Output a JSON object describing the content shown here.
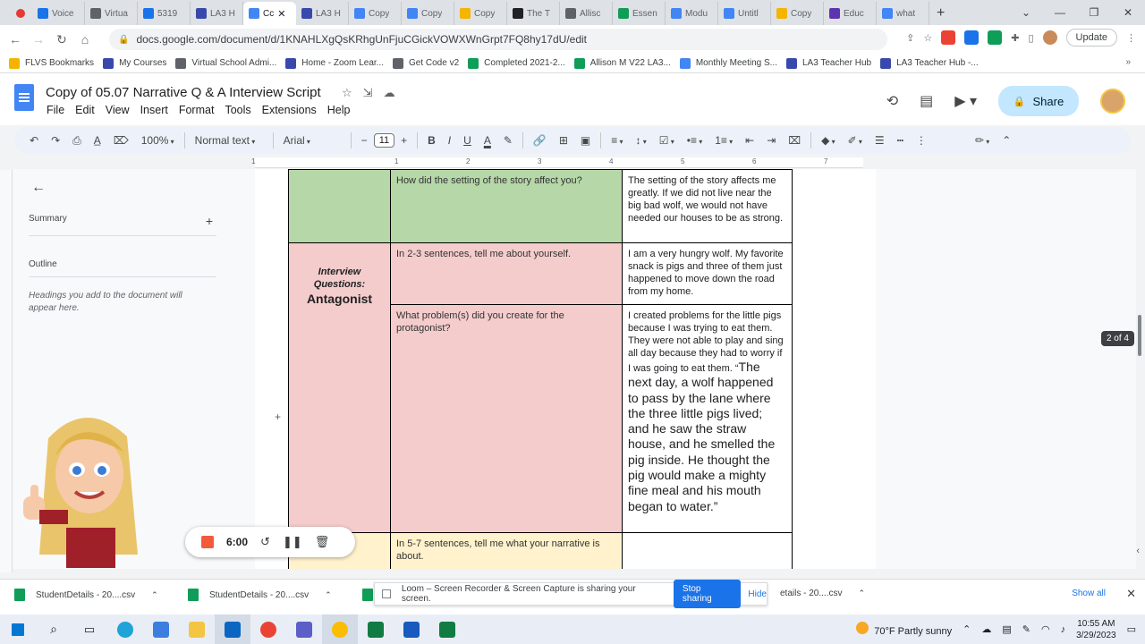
{
  "browser": {
    "tabs": [
      {
        "label": "Voice",
        "color": "#1a73e8"
      },
      {
        "label": "Virtua",
        "color": "#5f6368"
      },
      {
        "label": "5319",
        "color": "#1a73e8"
      },
      {
        "label": "LA3 H",
        "color": "#3949ab"
      },
      {
        "label": "Cc",
        "color": "#4285f4",
        "active": true
      },
      {
        "label": "LA3 H",
        "color": "#3949ab"
      },
      {
        "label": "Copy",
        "color": "#4285f4"
      },
      {
        "label": "Copy",
        "color": "#4285f4"
      },
      {
        "label": "Copy",
        "color": "#f4b400"
      },
      {
        "label": "The T",
        "color": "#202124"
      },
      {
        "label": "Allisc",
        "color": "#5f6368"
      },
      {
        "label": "Essen",
        "color": "#0f9d58"
      },
      {
        "label": "Modu",
        "color": "#4285f4"
      },
      {
        "label": "Untitl",
        "color": "#4285f4"
      },
      {
        "label": "Copy",
        "color": "#f4b400"
      },
      {
        "label": "Educ",
        "color": "#5e35b1"
      },
      {
        "label": "what",
        "color": "#4285f4"
      }
    ],
    "new_tab": "+",
    "url": "docs.google.com/document/d/1KNAHLXgQsKRhgUnFjuCGickVOWXWnGrpt7FQ8hy17dU/edit",
    "update_label": "Update",
    "bookmarks": [
      {
        "label": "FLVS Bookmarks",
        "color": "#f4b400"
      },
      {
        "label": "My Courses",
        "color": "#3949ab"
      },
      {
        "label": "Virtual School Admi...",
        "color": "#5f6368"
      },
      {
        "label": "Home - Zoom Lear...",
        "color": "#3949ab"
      },
      {
        "label": "Get Code v2",
        "color": "#5f6368"
      },
      {
        "label": "Completed 2021-2...",
        "color": "#0f9d58"
      },
      {
        "label": "Allison M V22 LA3...",
        "color": "#0f9d58"
      },
      {
        "label": "Monthly Meeting S...",
        "color": "#4285f4"
      },
      {
        "label": "LA3 Teacher Hub",
        "color": "#3949ab"
      },
      {
        "label": "LA3 Teacher Hub -...",
        "color": "#3949ab"
      }
    ]
  },
  "docs": {
    "title": "Copy of 05.07 Narrative Q & A Interview Script",
    "menu": [
      "File",
      "Edit",
      "View",
      "Insert",
      "Format",
      "Tools",
      "Extensions",
      "Help"
    ],
    "share_label": "Share",
    "toolbar": {
      "zoom": "100%",
      "style": "Normal text",
      "font": "Arial",
      "font_size": "11"
    },
    "ruler_numbers": [
      "1",
      "1",
      "2",
      "3",
      "4",
      "5",
      "6",
      "7"
    ],
    "sidebar": {
      "summary": "Summary",
      "outline": "Outline",
      "hint": "Headings you add to the document will appear here."
    },
    "table": {
      "setting_question": "How did the setting of the story affect you?",
      "setting_answer": "The setting of the story affects me greatly. If we did not live near the big bad wolf, we would not have needed our houses to be as strong.",
      "antagonist_label_small": "Interview Questions:",
      "antagonist_label_big": "Antagonist",
      "q1": "In 2-3 sentences, tell me about yourself.",
      "a1": "I am a very hungry wolf. My favorite snack is pigs and three of them just happened to move down the road from my home.",
      "q2": "What problem(s) did you create for the protagonist?",
      "a2": "I created problems for the little pigs because I was trying to eat them. They were not able to play and sing all day because they had to worry if I was going to eat them. “",
      "a2_quote": "The next day, a wolf happened to pass by the lane where the three little pigs lived; and he saw the straw house, and he smelled the pig inside. He thought the pig would make a mighty fine meal and his mouth began to water.”",
      "q3": "In 5-7 sentences, tell me what your narrative is about.",
      "a3": ""
    },
    "page_indicator": "2 of 4"
  },
  "loom": {
    "timer": "6:00",
    "banner_text": "Loom – Screen Recorder & Screen Capture is sharing your screen.",
    "stop_label": "Stop sharing",
    "hide_label": "Hide"
  },
  "downloads": {
    "items": [
      "StudentDetails - 20....csv",
      "StudentDetails - 20....csv",
      "etails - 20....csv"
    ],
    "show_all": "Show all"
  },
  "taskbar": {
    "weather": "70°F  Partly sunny",
    "time": "10:55 AM",
    "date": "3/29/2023"
  }
}
